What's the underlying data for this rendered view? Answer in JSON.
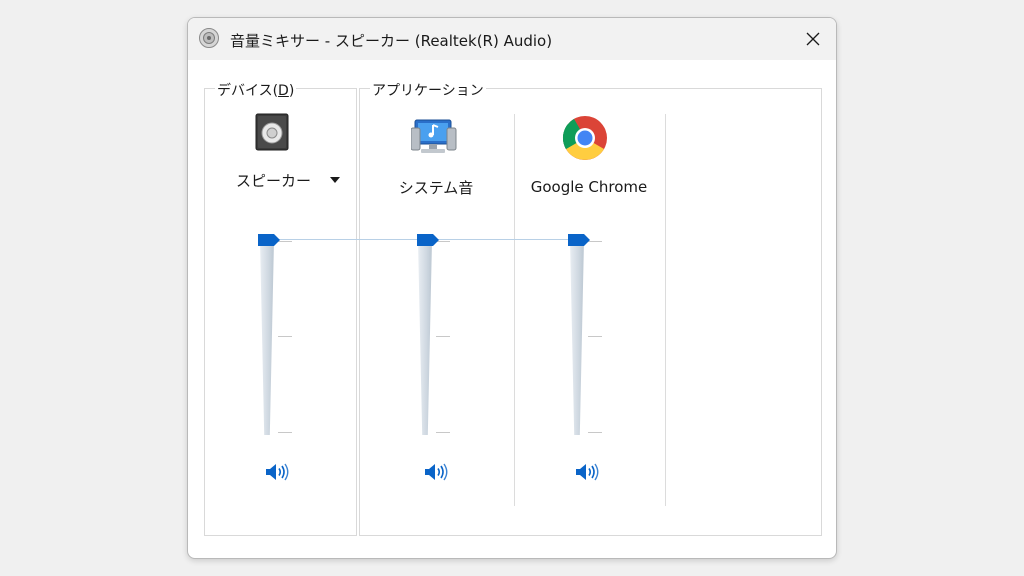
{
  "window": {
    "title": "音量ミキサー - スピーカー (Realtek(R) Audio)"
  },
  "device_group": {
    "label": "デバイス(",
    "mnemonic": "D",
    "label_end": ")",
    "device_name": "スピーカー"
  },
  "apps_group": {
    "label": "アプリケーション",
    "apps": [
      {
        "name": "システム音",
        "icon": "system-sounds-icon"
      },
      {
        "name": "Google Chrome",
        "icon": "chrome-icon"
      }
    ]
  },
  "sliders": {
    "speaker_level": 1.0,
    "system_sounds_level": 1.0,
    "chrome_level": 1.0
  },
  "colors": {
    "accent": "#0a64c8",
    "title_bg": "#f2f2f2"
  }
}
